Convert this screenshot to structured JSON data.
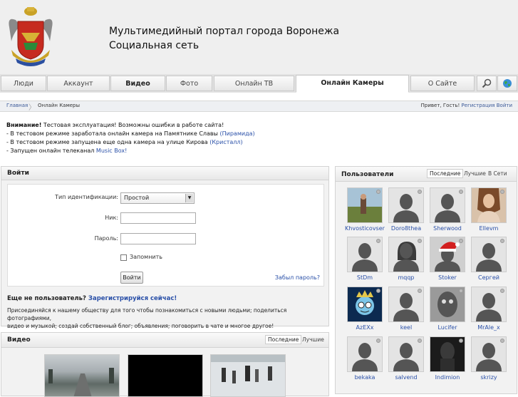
{
  "header": {
    "title": "Мультимедийный портал города Воронежа",
    "subtitle": "Социальная сеть",
    "logo_icon": "coat-of-arms-icon"
  },
  "nav": {
    "tabs": [
      {
        "label": "Люди"
      },
      {
        "label": "Аккаунт"
      },
      {
        "label": "Видео"
      },
      {
        "label": "Фото"
      },
      {
        "label": "Онлайн ТВ"
      },
      {
        "label": "Онлайн Камеры"
      },
      {
        "label": "О Сайте"
      }
    ],
    "search_icon": "search-icon",
    "globe_icon": "globe-icon"
  },
  "breadcrumb": {
    "home": "Главная",
    "current": "Онлайн Камеры",
    "greeting": "Привет, Гость!",
    "register": "Регистрация",
    "login": "Войти"
  },
  "notice": {
    "heading": "Внимание!",
    "line1": "Тестовая эксплуатация! Возможны ошибки в работе сайта!",
    "line2_prefix": "- В тестовом режиме заработала онлайн камера на Памятнике Славы",
    "line2_link": "(Пирамида)",
    "line3_prefix": "- В тестовом режиме запущена еще одна камера на улице Кирова",
    "line3_link": "(Кристалл)",
    "line4_prefix": "- Запущен онлайн телеканал",
    "line4_link": "Music Box!"
  },
  "login": {
    "title": "Войти",
    "id_type_label": "Тип идентификации:",
    "id_type_value": "Простой",
    "nick_label": "Ник:",
    "nick_value": "",
    "password_label": "Пароль:",
    "password_value": "",
    "remember_label": "Запомнить",
    "submit_label": "Войти",
    "forgot_label": "Забыл пароль?",
    "not_user": "Еще не пользователь?",
    "register_now": "Зарегистрируйся сейчас!",
    "join_text_1": "Присоединяйся к нашему обществу для того чтобы познакомиться с новыми людьми; поделиться фотографиями,",
    "join_text_2": "видео и музыкой; создай собственный блог; объявления; поговорить в чате и многое другое!"
  },
  "video": {
    "title": "Видео",
    "tab_latest": "Последние",
    "tab_best": "Лучшие"
  },
  "users": {
    "title": "Пользователи",
    "tab_latest": "Последние",
    "tab_best": "Лучшие",
    "tab_online": "В Сети",
    "list": [
      {
        "name": "Khvosticovser",
        "avatar": "photo"
      },
      {
        "name": "Doro8thea",
        "avatar": "silhouette"
      },
      {
        "name": "Sherwood",
        "avatar": "silhouette"
      },
      {
        "name": "Ellevm",
        "avatar": "photo"
      },
      {
        "name": "StDm",
        "avatar": "silhouette"
      },
      {
        "name": "mqqp",
        "avatar": "silhouette-female"
      },
      {
        "name": "Stoker",
        "avatar": "santa"
      },
      {
        "name": "Сергей",
        "avatar": "silhouette"
      },
      {
        "name": "AzEXx",
        "avatar": "cartoon"
      },
      {
        "name": "keel",
        "avatar": "silhouette"
      },
      {
        "name": "Lucifer",
        "avatar": "photo-gray"
      },
      {
        "name": "MrAle_x",
        "avatar": "silhouette"
      },
      {
        "name": "bekaka",
        "avatar": "silhouette"
      },
      {
        "name": "salvend",
        "avatar": "silhouette"
      },
      {
        "name": "Indimion",
        "avatar": "photo-dark"
      },
      {
        "name": "skrizy",
        "avatar": "silhouette"
      }
    ]
  }
}
